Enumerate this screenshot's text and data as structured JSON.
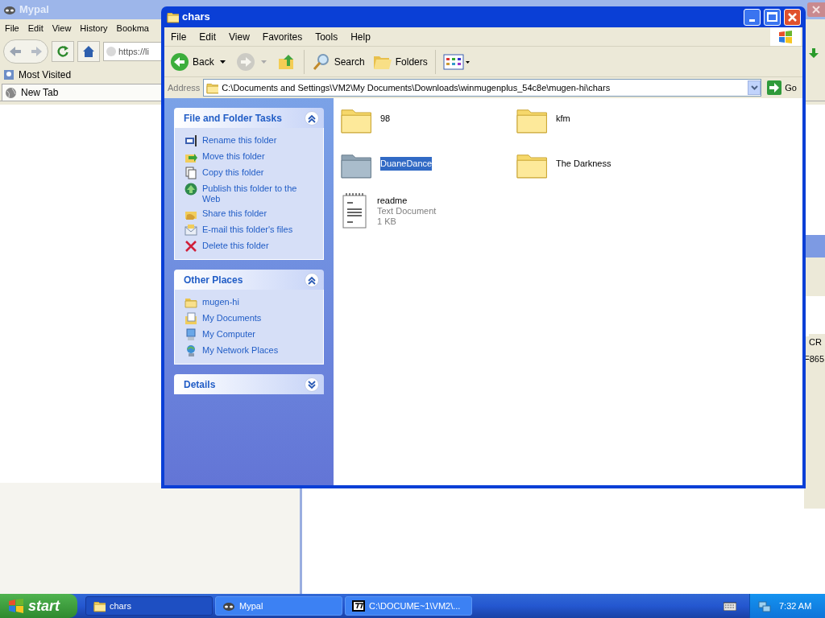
{
  "browser": {
    "title": "Mypal",
    "menu": [
      "File",
      "Edit",
      "View",
      "History",
      "Bookma"
    ],
    "url": "https://li",
    "bookmarks": [
      "Most Visited"
    ],
    "tabs": [
      {
        "label": "New Tab",
        "selected": true
      }
    ]
  },
  "background_window": {
    "column_header": "CR",
    "cell": "F865"
  },
  "explorer": {
    "title": "chars",
    "menu": [
      "File",
      "Edit",
      "View",
      "Favorites",
      "Tools",
      "Help"
    ],
    "toolbar": [
      {
        "kind": "back",
        "label": "Back",
        "disabled": false
      },
      {
        "kind": "forward",
        "disabled": true
      },
      {
        "kind": "up",
        "disabled": false
      },
      {
        "kind": "search",
        "label": "Search",
        "disabled": false
      },
      {
        "kind": "folders",
        "label": "Folders",
        "disabled": false
      },
      {
        "kind": "views",
        "disabled": false
      }
    ],
    "address_label": "Address",
    "address": "C:\\Documents and Settings\\VM2\\My Documents\\Downloads\\winmugenplus_54c8e\\mugen-hi\\chars",
    "go": "Go",
    "panels": [
      {
        "title": "File and Folder Tasks",
        "expanded": true,
        "items": [
          {
            "kind": "rename",
            "label": "Rename this folder"
          },
          {
            "kind": "move",
            "label": "Move this folder"
          },
          {
            "kind": "copy",
            "label": "Copy this folder"
          },
          {
            "kind": "publish",
            "label": "Publish this folder to the Web"
          },
          {
            "kind": "share",
            "label": "Share this folder"
          },
          {
            "kind": "email",
            "label": "E-mail this folder's files"
          },
          {
            "kind": "delete",
            "label": "Delete this folder"
          }
        ]
      },
      {
        "title": "Other Places",
        "expanded": true,
        "items": [
          {
            "kind": "folder",
            "label": "mugen-hi"
          },
          {
            "kind": "documents",
            "label": "My Documents"
          },
          {
            "kind": "computer",
            "label": "My Computer"
          },
          {
            "kind": "network",
            "label": "My Network Places"
          }
        ]
      },
      {
        "title": "Details",
        "expanded": false
      }
    ],
    "files": [
      {
        "kind": "folder",
        "name": "98",
        "selected": false
      },
      {
        "kind": "folder",
        "name": "kfm",
        "selected": false
      },
      {
        "kind": "folder",
        "name": "DuaneDance",
        "selected": true
      },
      {
        "kind": "folder",
        "name": "The Darkness",
        "selected": false
      },
      {
        "kind": "text",
        "name": "readme",
        "type": "Text Document",
        "size": "1 KB",
        "selected": false
      }
    ]
  },
  "taskbar": {
    "start": "start",
    "tasks": [
      {
        "kind": "folder",
        "label": "chars",
        "selected": true
      },
      {
        "kind": "browser",
        "label": "Mypal",
        "selected": false
      },
      {
        "kind": "archive",
        "label": "C:\\DOCUME~1\\VM2\\...",
        "selected": false
      }
    ],
    "clock": "7:32 AM"
  }
}
